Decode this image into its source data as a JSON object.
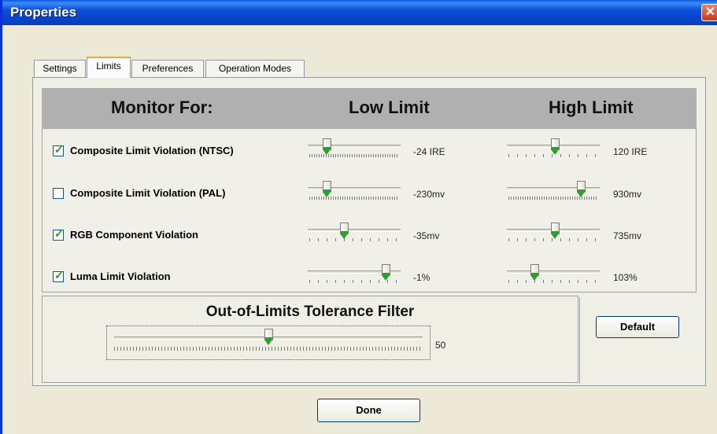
{
  "window": {
    "title": "Properties",
    "close_icon": "close-icon"
  },
  "tabs": [
    {
      "label": "Settings",
      "active": false
    },
    {
      "label": "Limits",
      "active": true
    },
    {
      "label": "Preferences",
      "active": false
    },
    {
      "label": "Operation Modes",
      "active": false
    }
  ],
  "headers": {
    "monitor_for": "Monitor For:",
    "low_limit": "Low Limit",
    "high_limit": "High Limit"
  },
  "rows": [
    {
      "label": "Composite Limit Violation (NTSC)",
      "checked": true,
      "low_value": "-24 IRE",
      "high_value": "120 IRE",
      "low_pos": 0.18,
      "high_pos": 0.52
    },
    {
      "label": "Composite Limit Violation (PAL)",
      "checked": false,
      "low_value": "-230mv",
      "high_value": "930mv",
      "low_pos": 0.18,
      "high_pos": 0.83
    },
    {
      "label": "RGB Component Violation",
      "checked": true,
      "low_value": "-35mv",
      "high_value": "735mv",
      "low_pos": 0.38,
      "high_pos": 0.52
    },
    {
      "label": "Luma Limit Violation",
      "checked": true,
      "low_value": "-1%",
      "high_value": "103%",
      "low_pos": 0.88,
      "high_pos": 0.28
    }
  ],
  "tolerance": {
    "title": "Out-of-Limits Tolerance Filter",
    "value": "50",
    "pos": 0.5
  },
  "buttons": {
    "default": "Default",
    "done": "Done"
  },
  "colors": {
    "title_bar": "#0a4fd6",
    "check_mark": "#21a121",
    "slider_tip": "#2ca02c",
    "header_band": "#b0b0b0"
  }
}
